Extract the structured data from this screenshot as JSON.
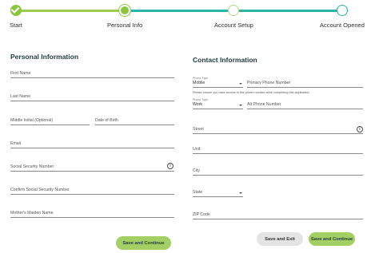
{
  "stepper": {
    "steps": [
      {
        "label": "Start",
        "state": "complete"
      },
      {
        "label": "Personal Info",
        "state": "current"
      },
      {
        "label": "Account Setup",
        "state": "upcoming"
      },
      {
        "label": "Account Opened",
        "state": "upcoming"
      }
    ]
  },
  "personal": {
    "title": "Personal Information",
    "first_name": "First Name",
    "last_name": "Last Name",
    "middle_initial": "Middle Initial (Optional)",
    "dob": "Date of Birth",
    "email": "Email",
    "ssn": "Social Security Number",
    "confirm_ssn": "Confirm Social Security Number",
    "maiden_name": "Mother's Maiden Name",
    "save_continue": "Save and Continue"
  },
  "contact": {
    "title": "Contact Information",
    "phone_type_label": "Phone Type",
    "primary_phone_type": "Mobile",
    "primary_phone_placeholder": "Primary Phone Number",
    "access_note": "Please ensure you have access to this phone number while completing this application.",
    "alt_phone_type_label": "Phone Type",
    "alt_phone_type": "Work",
    "alt_phone_placeholder": "Alt Phone Number",
    "street": "Street",
    "unit": "Unit",
    "city": "City",
    "state": "State",
    "zip": "ZIP Code",
    "save_exit": "Save and Exit",
    "save_continue": "Save and Continue"
  },
  "colors": {
    "accent_green": "#8cc63f",
    "button_green": "#a3d065",
    "teal": "#2bb5a8",
    "secondary_button": "#e4e4e4"
  }
}
